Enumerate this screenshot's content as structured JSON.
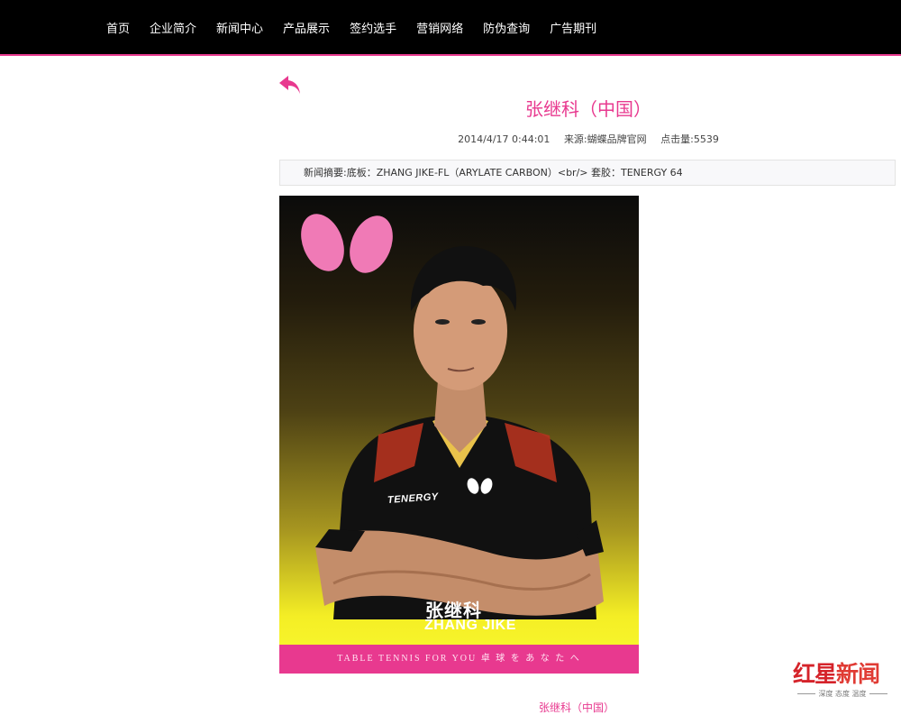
{
  "nav": {
    "items": [
      "首页",
      "企业简介",
      "新闻中心",
      "产品展示",
      "签约选手",
      "营销网络",
      "防伪查询",
      "广告期刊"
    ]
  },
  "article": {
    "title": "张继科（中国）",
    "date": "2014/4/17 0:44:01",
    "source": "来源:蝴蝶品牌官网",
    "clicks": "点击量:5539",
    "summary": "新闻摘要:底板：ZHANG JIKE-FL（ARYLATE CARBON）<br/> 套胶：TENERGY 64"
  },
  "poster": {
    "name_cn": "张继科",
    "name_en": "ZHANG JIKE",
    "shirt_brand": "TENERGY",
    "strip_text": "TABLE TENNIS FOR YOU   卓 球 を あ な た へ"
  },
  "bottom_link": "张继科（中国）",
  "watermark": {
    "logo_a": "红星",
    "logo_b": "新闻",
    "tagline": "深度 态度 温度"
  },
  "colors": {
    "accent": "#e8398f",
    "topbar": "#000000"
  },
  "icons": {
    "back": "back-arrow-icon",
    "butterfly": "butterfly-logo-icon"
  }
}
